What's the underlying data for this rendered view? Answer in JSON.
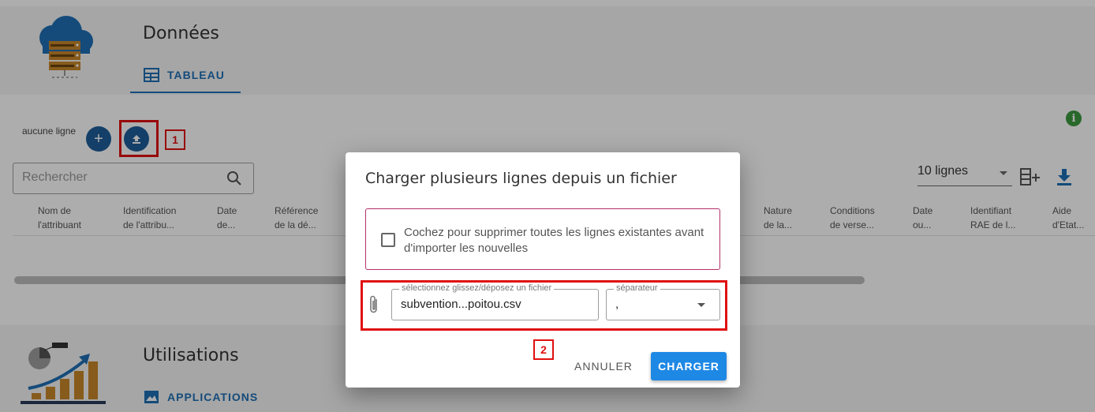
{
  "sections": {
    "data_title": "Données",
    "data_tab": "TABLEAU",
    "usage_title": "Utilisations",
    "usage_tab": "APPLICATIONS"
  },
  "toolbar": {
    "row_count": "aucune ligne",
    "add_label": "+",
    "search_placeholder": "Rechercher",
    "lines_select": "10 lignes",
    "info_label": "i"
  },
  "annotations": {
    "one": "1",
    "two": "2"
  },
  "table": {
    "columns": [
      [
        "Nom de",
        "l'attribuant"
      ],
      [
        "Identification",
        "de l'attribu..."
      ],
      [
        "Date",
        "de..."
      ],
      [
        "Référence",
        "de la dé..."
      ],
      [
        "Nature",
        "de la..."
      ],
      [
        "Conditions",
        "de verse..."
      ],
      [
        "Date",
        "ou..."
      ],
      [
        "Identifiant",
        "RAE de l..."
      ],
      [
        "Aide",
        "d'Etat..."
      ]
    ]
  },
  "dialog": {
    "title": "Charger plusieurs lignes depuis un fichier",
    "checkbox_label": "Cochez pour supprimer toutes les lignes existantes avant d'importer les nouvelles",
    "file_legend": "sélectionnez glissez/déposez un fichier",
    "file_value": "subvention...poitou.csv",
    "sep_legend": "séparateur",
    "sep_value": ",",
    "cancel_label": "ANNULER",
    "load_label": "CHARGER"
  },
  "colors": {
    "primary": "#1e6fb5",
    "accent_button": "#1e88e5",
    "annotation_red": "#e01010",
    "info_green": "#3c9a3f",
    "checkbox_border": "#b4306a"
  }
}
